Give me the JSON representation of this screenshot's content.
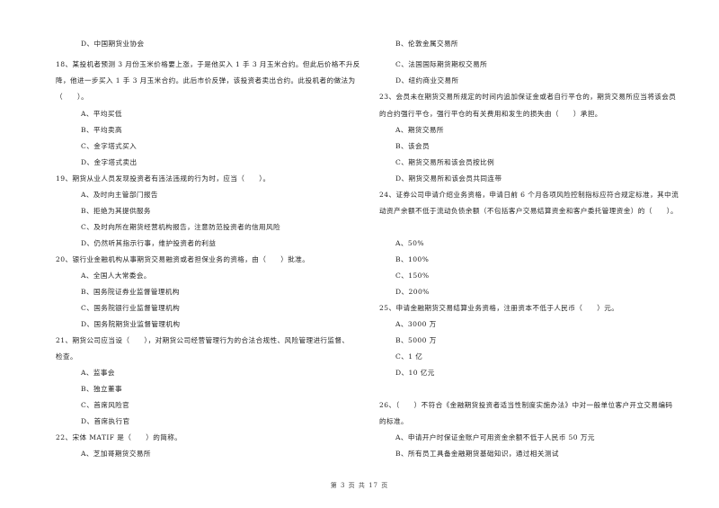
{
  "page": {
    "footer": "第 3 页 共 17 页"
  },
  "left_column": {
    "q17_tail": {
      "option_d": "D、中国期货业协会"
    },
    "q18": {
      "stem_line1": "18、某投机者预测 3 月份玉米价格要上涨，于是他买入 1 手 3 月玉米合约。但此后价格不升反",
      "stem_line2": "降，他进一步买入 1 手 3 月玉米合约。此后市价反弹，该投资者卖出合约。此投机者的做法为",
      "stem_line3": "（　　）。",
      "options": [
        "A、平均买低",
        "B、平均卖高",
        "C、金字塔式买入",
        "D、金字塔式卖出"
      ]
    },
    "q19": {
      "stem_line1": "19、期货从业人员发现投资者有违法违规的行为时，应当（　　）。",
      "options": [
        "A、及时向主管部门报告",
        "B、拒绝为其提供服务",
        "C、及时向所在期货经营机构报告，注意防范投资者的信用风险",
        "D、仍然听其指示行事，维护投资者的利益"
      ]
    },
    "q20": {
      "stem_line1": "20、银行业金融机构从事期货交易融资或者担保业务的资格，由（　　）批准。",
      "options": [
        "A、全国人大常委会。",
        "B、国务院证券业监督管理机构",
        "C、国务院银行业监督管理机构",
        "D、国务院期货业监督管理机构"
      ]
    },
    "q21": {
      "stem_line1": "21、期货公司应当设（　　），对期货公司经营管理行为的合法合规性、风险管理进行监督、",
      "stem_line2": "检查。",
      "options": [
        "A、监事会",
        "B、独立董事",
        "C、首席风险官",
        "D、首席执行官"
      ]
    },
    "q22": {
      "stem_line1": "22、宋体 MATIF 是（　　）的简称。",
      "options": [
        "A、芝加哥期货交易所"
      ]
    }
  },
  "right_column": {
    "q22_tail": {
      "options": [
        "B、伦敦金属交易所",
        "C、法国国际期货期权交易所",
        "D、纽约商业交易所"
      ]
    },
    "q23": {
      "stem_line1": "23、会员未在期货交易所规定的时间内追加保证金或者自行平仓的，期货交易所应当将该会员",
      "stem_line2": "的合约强行平仓，强行平仓的有关费用和发生的损失由（　　）承担。",
      "options": [
        "A、期货交易所",
        "B、该会员",
        "C、期货交易所和该会员按比例",
        "D、期货交易所和该会员共同连带"
      ]
    },
    "q24": {
      "stem_line1": "24、证券公司申请介绍业务资格，申请日前 6 个月各项风险控制指标应符合规定标准，其中流",
      "stem_line2": "动资产余额不低于流动负债余额（不包括客户交易结算资金和客户委托管理资金）的（　　）。",
      "options": [
        "A、50%",
        "B、100%",
        "C、150%",
        "D、200%"
      ]
    },
    "q25": {
      "stem_line1": "25、申请金融期货交易结算业务资格，注册资本不低于人民币（　　）元。",
      "options": [
        "A、3000 万",
        "B、5000 万",
        "C、1 亿",
        "D、10 亿元"
      ]
    },
    "q26": {
      "stem_line1": "26、（　　）不符合《金融期货投资者适当性制度实施办法》中对一般单位客户开立交易编码",
      "stem_line2": "的标准。",
      "options": [
        "A、申请开户时保证金账户可用资金余额不低于人民币 50 万元",
        "B、所有员工具备金融期货基础知识，通过相关测试"
      ]
    }
  }
}
